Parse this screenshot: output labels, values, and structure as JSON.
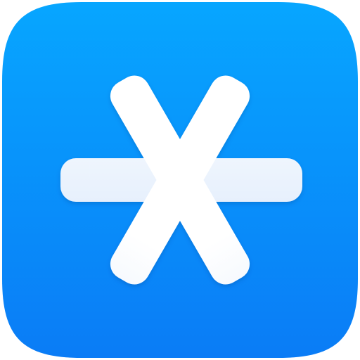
{
  "app_icon": {
    "icon_name": "asterisk-icon",
    "colors": {
      "tile_top": "#07a6ff",
      "tile_bottom": "#0a7cf6",
      "glyph_top": "#ffffff",
      "glyph_bottom": "#d6e6fb",
      "page_background": "#ffffff"
    }
  }
}
